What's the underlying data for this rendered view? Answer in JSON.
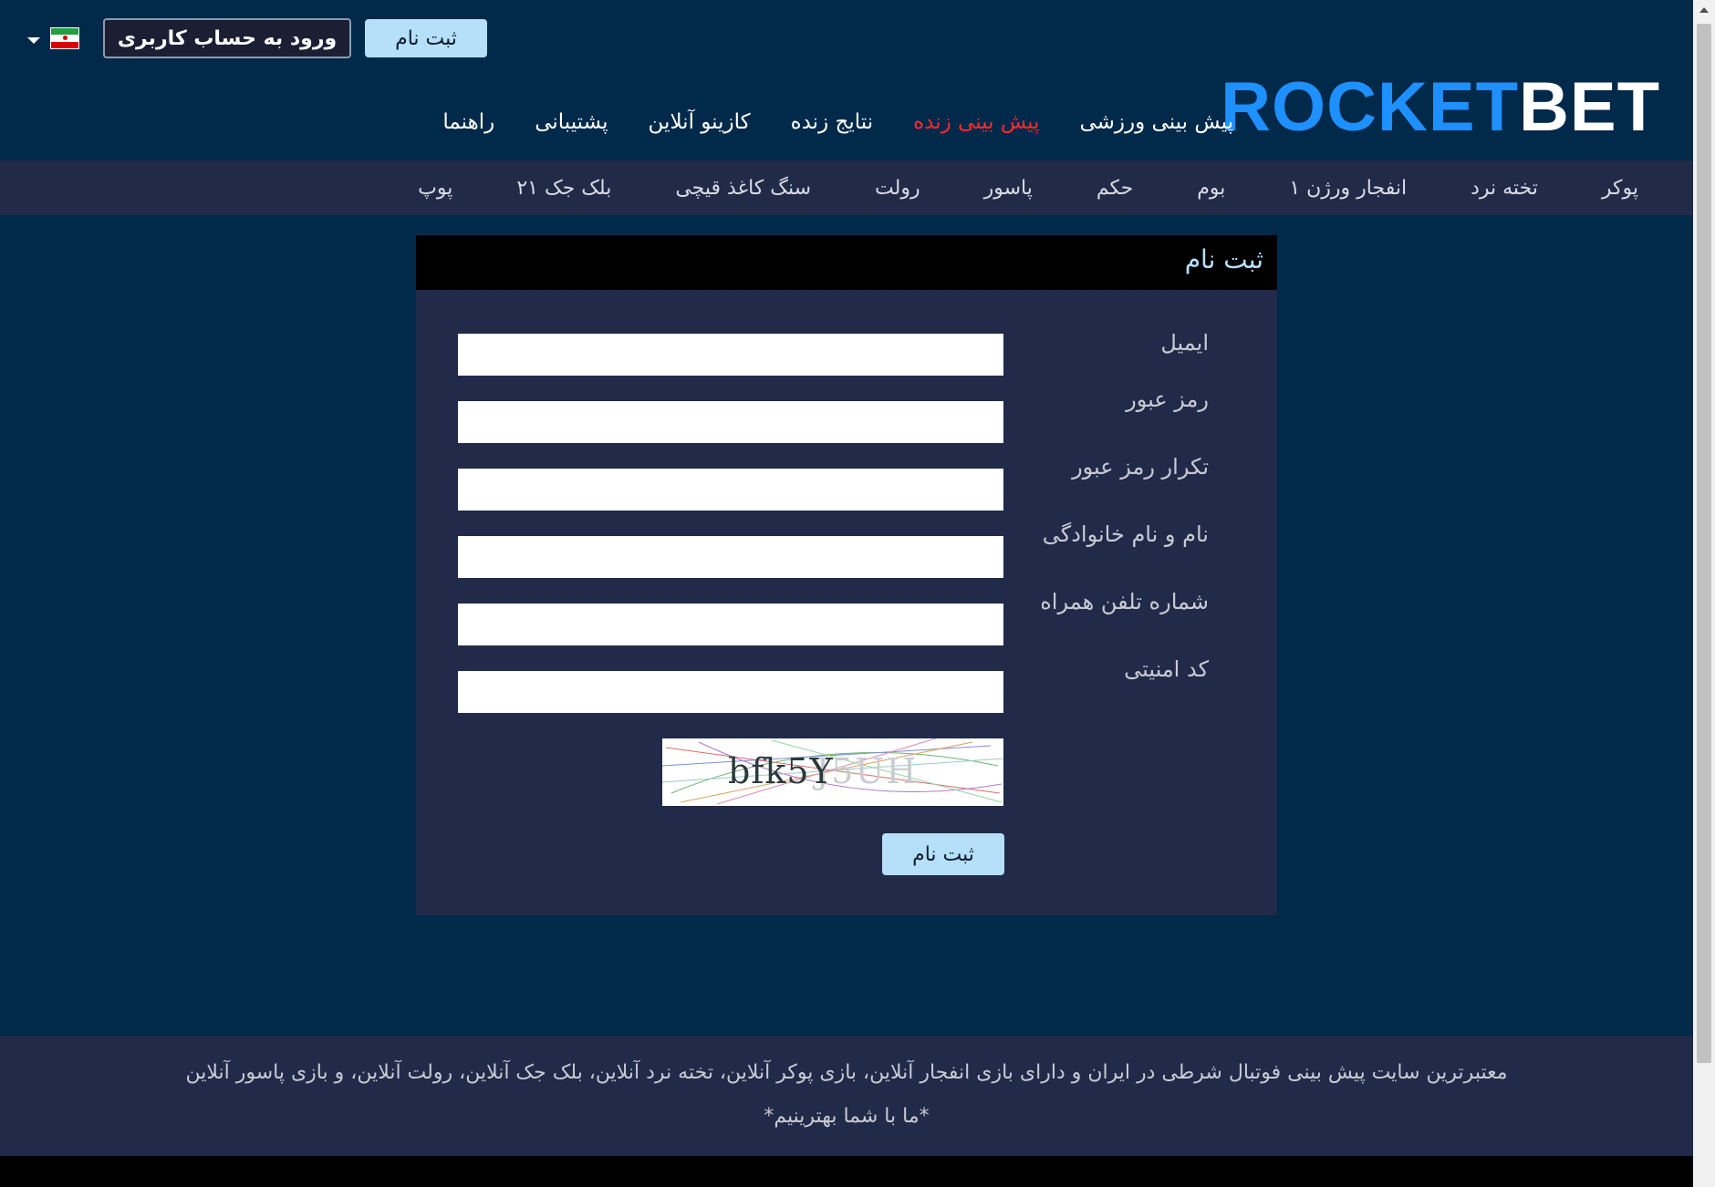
{
  "header": {
    "register_label": "ثبت نام",
    "login_label": "ورود به حساب کاربری",
    "language_flag": "iran-flag-icon",
    "logo": {
      "part1": "ROCKET",
      "part2": "BET"
    }
  },
  "main_nav": [
    {
      "label": "پیش بینی ورزشی",
      "active": false
    },
    {
      "label": "پیش بینی زنده",
      "active": true
    },
    {
      "label": "نتایج زنده",
      "active": false
    },
    {
      "label": "کازینو آنلاین",
      "active": false
    },
    {
      "label": "پشتیبانی",
      "active": false
    },
    {
      "label": "راهنما",
      "active": false
    }
  ],
  "sub_nav": [
    "پوکر",
    "تخته نرد",
    "انفجار ورژن ۱",
    "بوم",
    "حکم",
    "پاسور",
    "رولت",
    "سنگ کاغذ قیچی",
    "بلک جک ۲۱",
    "پوپ"
  ],
  "form": {
    "title": "ثبت نام",
    "fields": [
      {
        "label": "ایمیل",
        "value": ""
      },
      {
        "label": "رمز عبور",
        "value": ""
      },
      {
        "label": "تکرار رمز عبور",
        "value": ""
      },
      {
        "label": "نام و نام خانوادگی",
        "value": ""
      },
      {
        "label": "شماره تلفن همراه",
        "value": ""
      },
      {
        "label": "کد امنیتی",
        "value": ""
      }
    ],
    "captcha_text": "bfk5Y",
    "submit_label": "ثبت نام"
  },
  "footer": {
    "line1": "معتبرترین سایت پیش بینی فوتبال شرطی در ایران و دارای بازی انفجار آنلاین، بازی پوکر آنلاین، تخته نرد آنلاین، بلک جک آنلاین، رولت آنلاین، و بازی پاسور آنلاین",
    "line2": "*ما با شما بهترینیم*"
  },
  "colors": {
    "background": "#00294a",
    "accent_button": "#b6dff9",
    "active_nav": "#ff2a2a",
    "logo_blue": "#1e90ff",
    "panel": "#212a48"
  }
}
